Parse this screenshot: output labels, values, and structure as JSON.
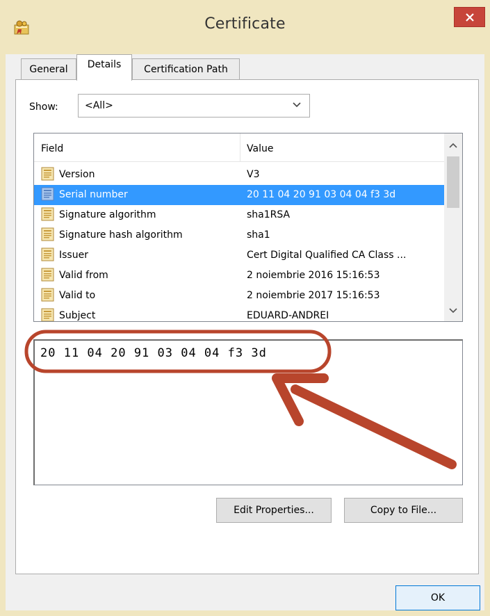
{
  "window": {
    "title": "Certificate",
    "close_glyph": "✕"
  },
  "tabs": [
    {
      "label": "General",
      "active": false
    },
    {
      "label": "Details",
      "active": true
    },
    {
      "label": "Certification Path",
      "active": false
    }
  ],
  "show": {
    "label": "Show:",
    "selected": "<All>"
  },
  "list": {
    "columns": [
      "Field",
      "Value"
    ],
    "rows": [
      {
        "field": "Version",
        "value": "V3",
        "selected": false
      },
      {
        "field": "Serial number",
        "value": "20 11 04 20 91 03 04 04 f3 3d",
        "selected": true
      },
      {
        "field": "Signature algorithm",
        "value": "sha1RSA",
        "selected": false
      },
      {
        "field": "Signature hash algorithm",
        "value": "sha1",
        "selected": false
      },
      {
        "field": "Issuer",
        "value": "Cert Digital Qualified CA Class ...",
        "selected": false
      },
      {
        "field": "Valid from",
        "value": "2 noiembrie 2016 15:16:53",
        "selected": false
      },
      {
        "field": "Valid to",
        "value": "2 noiembrie 2017 15:16:53",
        "selected": false
      },
      {
        "field": "Subject",
        "value": "EDUARD-ANDREI",
        "selected": false
      }
    ]
  },
  "detail": {
    "text": "20 11 04 20 91 03 04 04 f3 3d"
  },
  "buttons": {
    "edit_properties": "Edit Properties...",
    "copy_to_file": "Copy to File...",
    "ok": "OK"
  },
  "icons": {
    "app": "certificate-icon",
    "field": "field-document-icon",
    "close": "close-icon",
    "dropdown": "chevron-down-icon"
  },
  "colors": {
    "title_bar": "#f0e6c0",
    "close_button": "#c7453a",
    "selection": "#3399ff",
    "annotation": "#b8452c"
  }
}
